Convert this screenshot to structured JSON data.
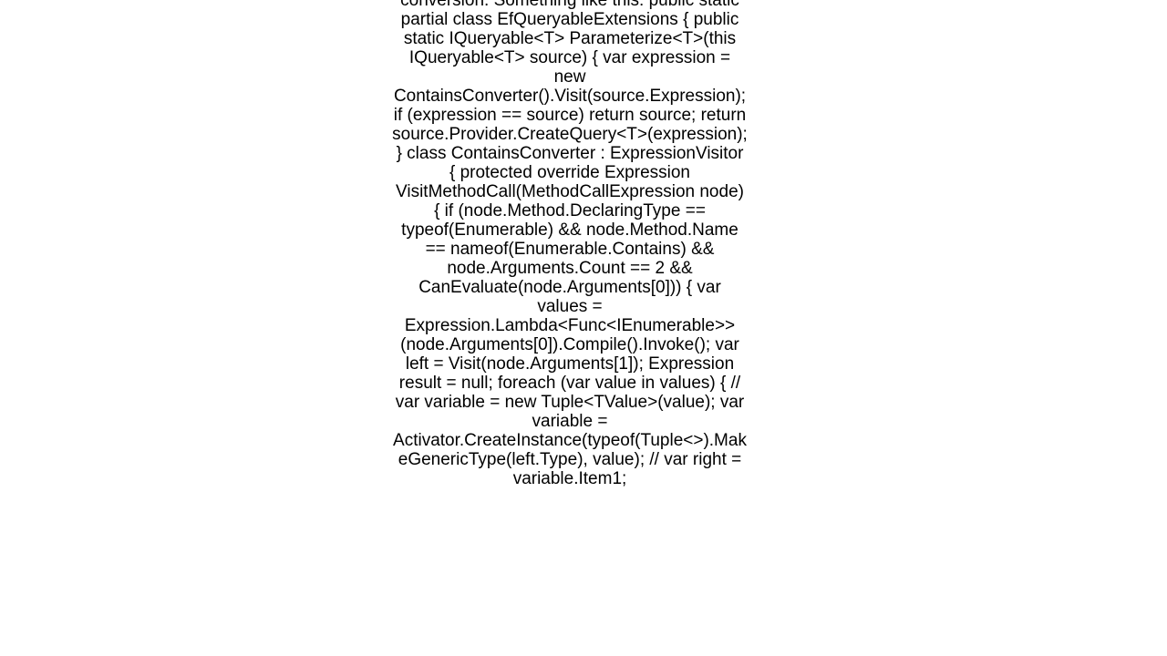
{
  "document": {
    "text": "conversion. Something like this: public static partial class EfQueryableExtensions {     public static IQueryable<T> Parameterize<T>(this IQueryable<T> source)     {         var expression = new ContainsConverter().Visit(source.Expression);         if (expression == source) return source;         return source.Provider.CreateQuery<T>(expression);     }     class ContainsConverter : ExpressionVisitor     {         protected override Expression VisitMethodCall(MethodCallExpression node)         {             if (node.Method.DeclaringType == typeof(Enumerable) &&                 node.Method.Name == nameof(Enumerable.Contains) &&                 node.Arguments.Count == 2 &&                 CanEvaluate(node.Arguments[0]))             {                 var values = Expression.Lambda<Func<IEnumerable>>(node.Arguments[0]).Compile().Invoke();                 var left = Visit(node.Arguments[1]);                 Expression result = null;                 foreach (var value in values)                 {                     // var variable = new Tuple<TValue>(value);                     var variable = Activator.CreateInstance(typeof(Tuple<>).MakeGenericType(left.Type), value);                     // var right = variable.Item1;"
  }
}
